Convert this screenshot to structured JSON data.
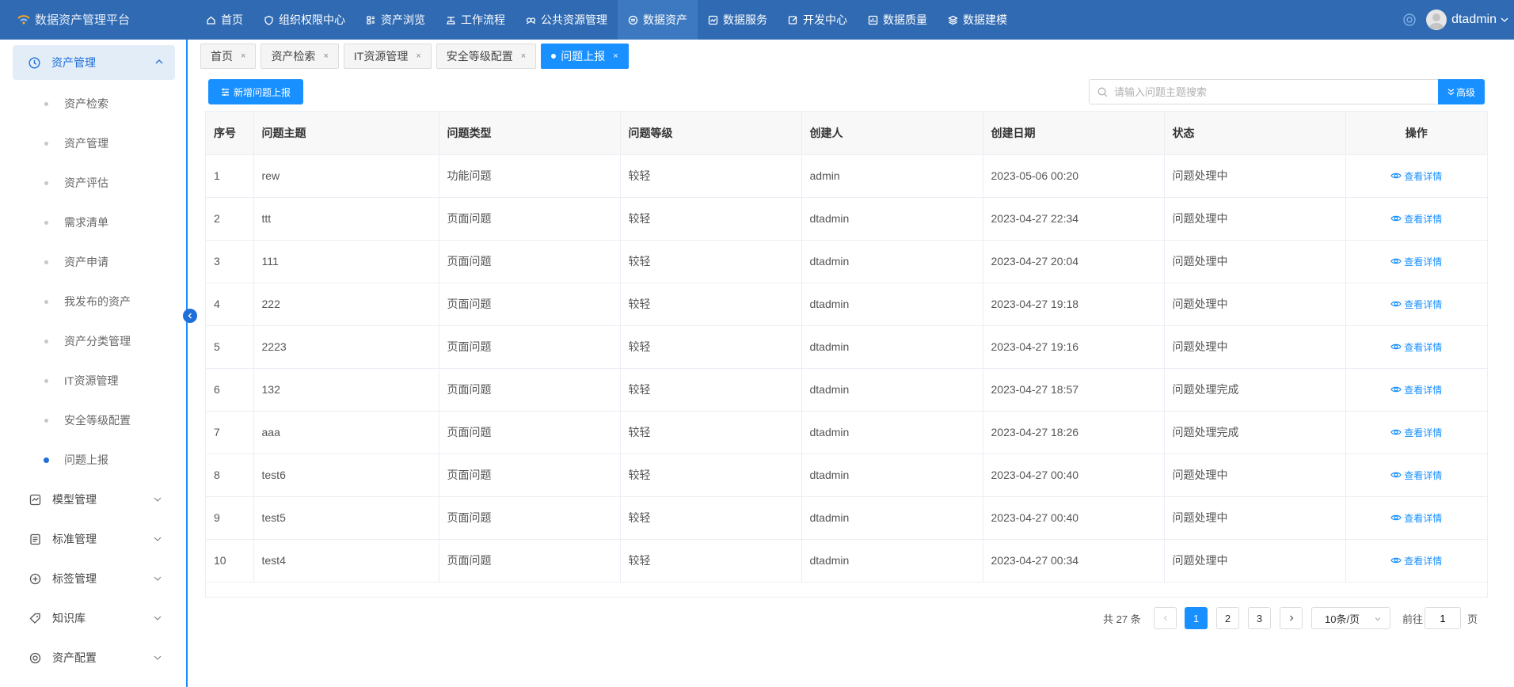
{
  "app": {
    "title": "数据资产管理平台"
  },
  "nav": {
    "items": [
      {
        "label": "首页",
        "icon": "home-icon"
      },
      {
        "label": "组织权限中心",
        "icon": "shield-icon"
      },
      {
        "label": "资产浏览",
        "icon": "grid-icon"
      },
      {
        "label": "工作流程",
        "icon": "flow-icon"
      },
      {
        "label": "公共资源管理",
        "icon": "resource-icon"
      },
      {
        "label": "数据资产",
        "icon": "asset-icon",
        "active": true
      },
      {
        "label": "数据服务",
        "icon": "service-icon"
      },
      {
        "label": "开发中心",
        "icon": "edit-icon"
      },
      {
        "label": "数据质量",
        "icon": "chart-icon"
      },
      {
        "label": "数据建模",
        "icon": "layers-icon"
      }
    ]
  },
  "user": {
    "name": "dtadmin"
  },
  "sidebar": {
    "active_group": "资产管理",
    "sub_items": [
      "资产检索",
      "资产管理",
      "资产评估",
      "需求清单",
      "资产申请",
      "我发布的资产",
      "资产分类管理",
      "IT资源管理",
      "安全等级配置",
      "问题上报"
    ],
    "active_sub": "问题上报",
    "groups": [
      "模型管理",
      "标准管理",
      "标签管理",
      "知识库",
      "资产配置"
    ]
  },
  "tabs": [
    {
      "label": "首页"
    },
    {
      "label": "资产检索"
    },
    {
      "label": "IT资源管理"
    },
    {
      "label": "安全等级配置"
    },
    {
      "label": "问题上报",
      "active": true
    }
  ],
  "toolbar": {
    "add_label": "新增问题上报",
    "search_placeholder": "请输入问题主题搜索",
    "advanced_label": "高级"
  },
  "table": {
    "columns": [
      "序号",
      "问题主题",
      "问题类型",
      "问题等级",
      "创建人",
      "创建日期",
      "状态",
      "操作"
    ],
    "action_label": "查看详情",
    "rows": [
      [
        "1",
        "rew",
        "功能问题",
        "较轻",
        "admin",
        "2023-05-06 00:20",
        "问题处理中"
      ],
      [
        "2",
        "ttt",
        "页面问题",
        "较轻",
        "dtadmin",
        "2023-04-27 22:34",
        "问题处理中"
      ],
      [
        "3",
        "111",
        "页面问题",
        "较轻",
        "dtadmin",
        "2023-04-27 20:04",
        "问题处理中"
      ],
      [
        "4",
        "222",
        "页面问题",
        "较轻",
        "dtadmin",
        "2023-04-27 19:18",
        "问题处理中"
      ],
      [
        "5",
        "2223",
        "页面问题",
        "较轻",
        "dtadmin",
        "2023-04-27 19:16",
        "问题处理中"
      ],
      [
        "6",
        "132",
        "页面问题",
        "较轻",
        "dtadmin",
        "2023-04-27 18:57",
        "问题处理完成"
      ],
      [
        "7",
        "aaa",
        "页面问题",
        "较轻",
        "dtadmin",
        "2023-04-27 18:26",
        "问题处理完成"
      ],
      [
        "8",
        "test6",
        "页面问题",
        "较轻",
        "dtadmin",
        "2023-04-27 00:40",
        "问题处理中"
      ],
      [
        "9",
        "test5",
        "页面问题",
        "较轻",
        "dtadmin",
        "2023-04-27 00:40",
        "问题处理中"
      ],
      [
        "10",
        "test4",
        "页面问题",
        "较轻",
        "dtadmin",
        "2023-04-27 00:34",
        "问题处理中"
      ]
    ]
  },
  "pagination": {
    "total_text": "共 27 条",
    "pages": [
      "1",
      "2",
      "3"
    ],
    "current": "1",
    "page_size": "10条/页",
    "goto_label": "前往",
    "goto_value": "1",
    "page_unit": "页"
  },
  "colors": {
    "primary": "#1890ff",
    "topbar": "#2f6ab3",
    "active_menu_bg": "#e3edf8"
  }
}
